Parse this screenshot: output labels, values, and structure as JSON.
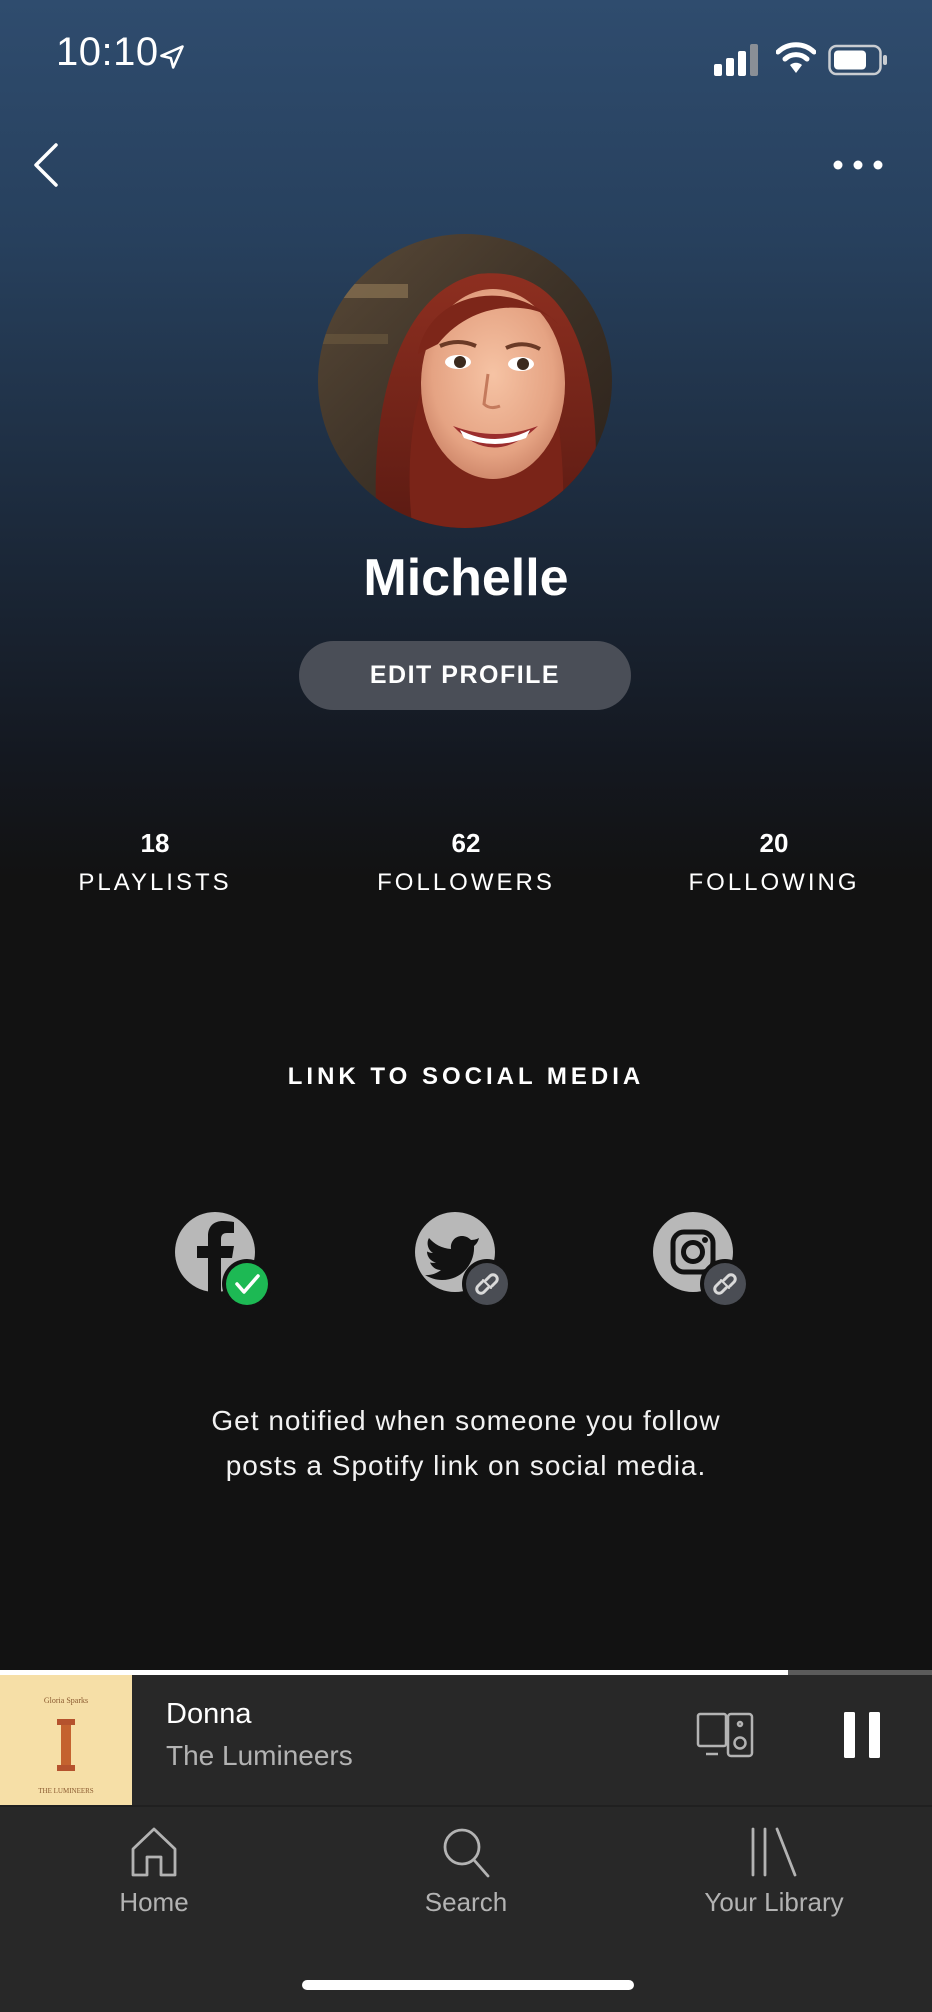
{
  "status_bar": {
    "time": "10:10"
  },
  "profile": {
    "name": "Michelle",
    "edit_button_label": "EDIT PROFILE"
  },
  "stats": [
    {
      "count": "18",
      "label": "PLAYLISTS"
    },
    {
      "count": "62",
      "label": "FOLLOWERS"
    },
    {
      "count": "20",
      "label": "FOLLOWING"
    }
  ],
  "social": {
    "heading": "LINK TO SOCIAL MEDIA",
    "accounts": [
      {
        "icon": "facebook-icon",
        "status": "linked"
      },
      {
        "icon": "twitter-icon",
        "status": "not-linked"
      },
      {
        "icon": "instagram-icon",
        "status": "not-linked"
      }
    ],
    "description_line1": "Get notified when someone you follow",
    "description_line2": "posts a Spotify link on social media."
  },
  "now_playing": {
    "title": "Donna",
    "artist": "The Lumineers",
    "album_art_text_top": "Gloria Sparks",
    "album_art_text_bottom": "THE LUMINEERS",
    "progress": 0.846
  },
  "tabs": [
    {
      "label": "Home",
      "icon": "home-icon"
    },
    {
      "label": "Search",
      "icon": "search-icon"
    },
    {
      "label": "Your Library",
      "icon": "library-icon"
    }
  ],
  "colors": {
    "accent_green": "#1db954",
    "background": "#121212",
    "header_gradient_top": "#2f4c6e",
    "player_bg": "#282828"
  }
}
